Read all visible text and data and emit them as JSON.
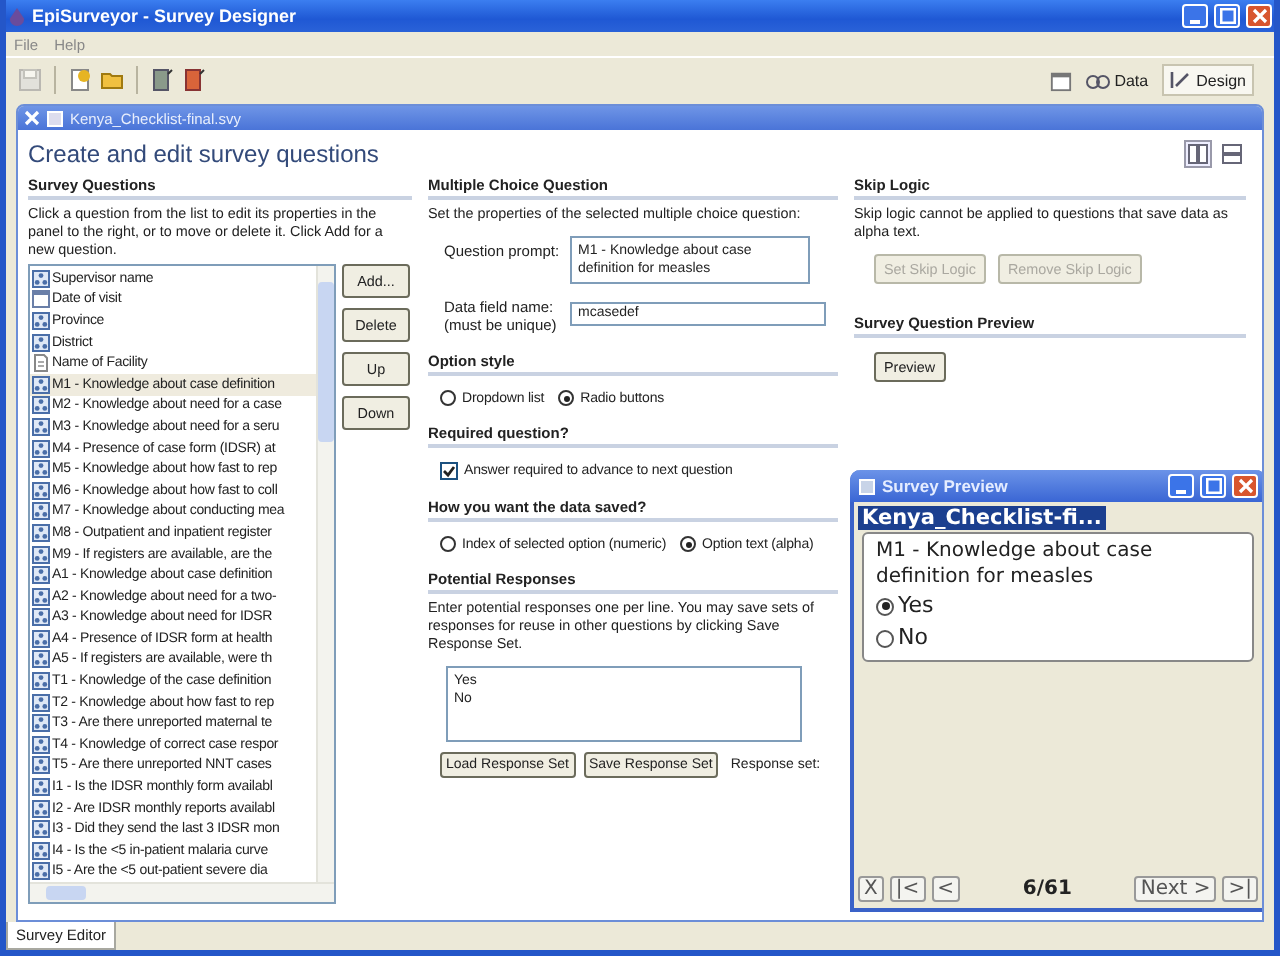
{
  "window": {
    "title": "EpiSurveyor - Survey Designer"
  },
  "menu": [
    "File",
    "Help"
  ],
  "view_tabs": [
    {
      "label": "Data",
      "selected": false
    },
    {
      "label": "Design",
      "selected": true
    }
  ],
  "document_tab": {
    "title": "Kenya_Checklist-final.svy"
  },
  "page_title": "Create and edit survey questions",
  "layout_buttons": [
    {
      "selected": true
    },
    {
      "selected": false
    }
  ],
  "questions_panel": {
    "heading": "Survey Questions",
    "description": "Click a question from the list to edit its properties in the panel to the right, or to move or delete it. Click Add for a new question.",
    "items": [
      {
        "label": "Supervisor name",
        "kind": "choice",
        "selected": false
      },
      {
        "label": "Date of visit",
        "kind": "date",
        "selected": false
      },
      {
        "label": "Province",
        "kind": "choice",
        "selected": false
      },
      {
        "label": "District",
        "kind": "choice",
        "selected": false
      },
      {
        "label": "Name of Facility",
        "kind": "text",
        "selected": false
      },
      {
        "label": "M1 - Knowledge about case definition",
        "kind": "choice",
        "selected": true
      },
      {
        "label": "M2 - Knowledge about need for a case",
        "kind": "choice",
        "selected": false
      },
      {
        "label": "M3 - Knowledge about need for a seru",
        "kind": "choice",
        "selected": false
      },
      {
        "label": "M4 - Presence of case form (IDSR) at",
        "kind": "choice",
        "selected": false
      },
      {
        "label": "M5 - Knowledge about how fast to rep",
        "kind": "choice",
        "selected": false
      },
      {
        "label": "M6 - Knowledge about how fast to coll",
        "kind": "choice",
        "selected": false
      },
      {
        "label": "M7 - Knowledge about conducting mea",
        "kind": "choice",
        "selected": false
      },
      {
        "label": "M8 - Outpatient and inpatient register",
        "kind": "choice",
        "selected": false
      },
      {
        "label": "M9 - If registers are available, are the",
        "kind": "choice",
        "selected": false
      },
      {
        "label": "A1 - Knowledge about case definition",
        "kind": "choice",
        "selected": false
      },
      {
        "label": "A2 - Knowledge about need for a two-",
        "kind": "choice",
        "selected": false
      },
      {
        "label": "A3 - Knowledge about need for IDSR",
        "kind": "choice",
        "selected": false
      },
      {
        "label": "A4 - Presence of IDSR form at health",
        "kind": "choice",
        "selected": false
      },
      {
        "label": "A5 - If registers are available, were th",
        "kind": "choice",
        "selected": false
      },
      {
        "label": "T1 - Knowledge of the case definition",
        "kind": "choice",
        "selected": false
      },
      {
        "label": "T2 - Knowledge about how fast to rep",
        "kind": "choice",
        "selected": false
      },
      {
        "label": "T3 - Are there unreported maternal te",
        "kind": "choice",
        "selected": false
      },
      {
        "label": "T4 - Knowledge of correct case respor",
        "kind": "choice",
        "selected": false
      },
      {
        "label": "T5 - Are there unreported NNT cases",
        "kind": "choice",
        "selected": false
      },
      {
        "label": "I1 - Is the IDSR monthly form availabl",
        "kind": "choice",
        "selected": false
      },
      {
        "label": "I2 - Are IDSR monthly reports availabl",
        "kind": "choice",
        "selected": false
      },
      {
        "label": "I3 - Did they send the last 3 IDSR mon",
        "kind": "choice",
        "selected": false
      },
      {
        "label": "I4 - Is the <5 in-patient malaria curve",
        "kind": "choice",
        "selected": false
      },
      {
        "label": "I5 - Are the <5 out-patient severe dia",
        "kind": "choice",
        "selected": false
      }
    ],
    "buttons": [
      "Add...",
      "Delete",
      "Up",
      "Down"
    ]
  },
  "question_editor": {
    "heading": "Multiple Choice Question",
    "description": "Set the properties of the selected multiple choice question:",
    "prompt_label": "Question prompt:",
    "prompt_value": "M1 - Knowledge about case definition for measles",
    "field_label": "Data field name:",
    "field_note": "(must be unique)",
    "field_value": "mcasedef",
    "option_style_heading": "Option style",
    "option_style": [
      {
        "label": "Dropdown list",
        "selected": false
      },
      {
        "label": "Radio buttons",
        "selected": true
      }
    ],
    "required_heading": "Required question?",
    "required": {
      "label": "Answer required to advance to next question",
      "checked": true
    },
    "saved_heading": "How you want the data saved?",
    "saved_as": [
      {
        "label": "Index of selected option (numeric)",
        "selected": false
      },
      {
        "label": "Option text (alpha)",
        "selected": true
      }
    ],
    "responses_heading": "Potential Responses",
    "responses_description": "Enter potential responses one per line. You may save sets of responses for reuse in other questions by clicking Save Response Set.",
    "responses": [
      "Yes",
      "No"
    ],
    "response_buttons": [
      "Load Response Set",
      "Save Response Set"
    ],
    "response_set_label": "Response set:"
  },
  "skip_logic": {
    "heading": "Skip Logic",
    "description": "Skip logic cannot be applied to questions that save data as alpha text.",
    "buttons": [
      {
        "label": "Set Skip Logic",
        "disabled": true
      },
      {
        "label": "Remove Skip Logic",
        "disabled": true
      }
    ]
  },
  "preview_section": {
    "heading": "Survey Question Preview",
    "button": "Preview"
  },
  "preview_window": {
    "title": "Survey Preview",
    "survey_name": "Kenya_Checklist-fi...",
    "question": "M1 - Knowledge about case definition for measles",
    "options": [
      {
        "label": "Yes",
        "selected": true
      },
      {
        "label": "No",
        "selected": false
      }
    ],
    "left_buttons": [
      "X",
      "|<",
      "<"
    ],
    "counter": "6/61",
    "right_buttons": [
      "Next >",
      ">|"
    ]
  },
  "bottom_tabs": [
    {
      "label": "Survey Editor",
      "selected": true
    }
  ]
}
